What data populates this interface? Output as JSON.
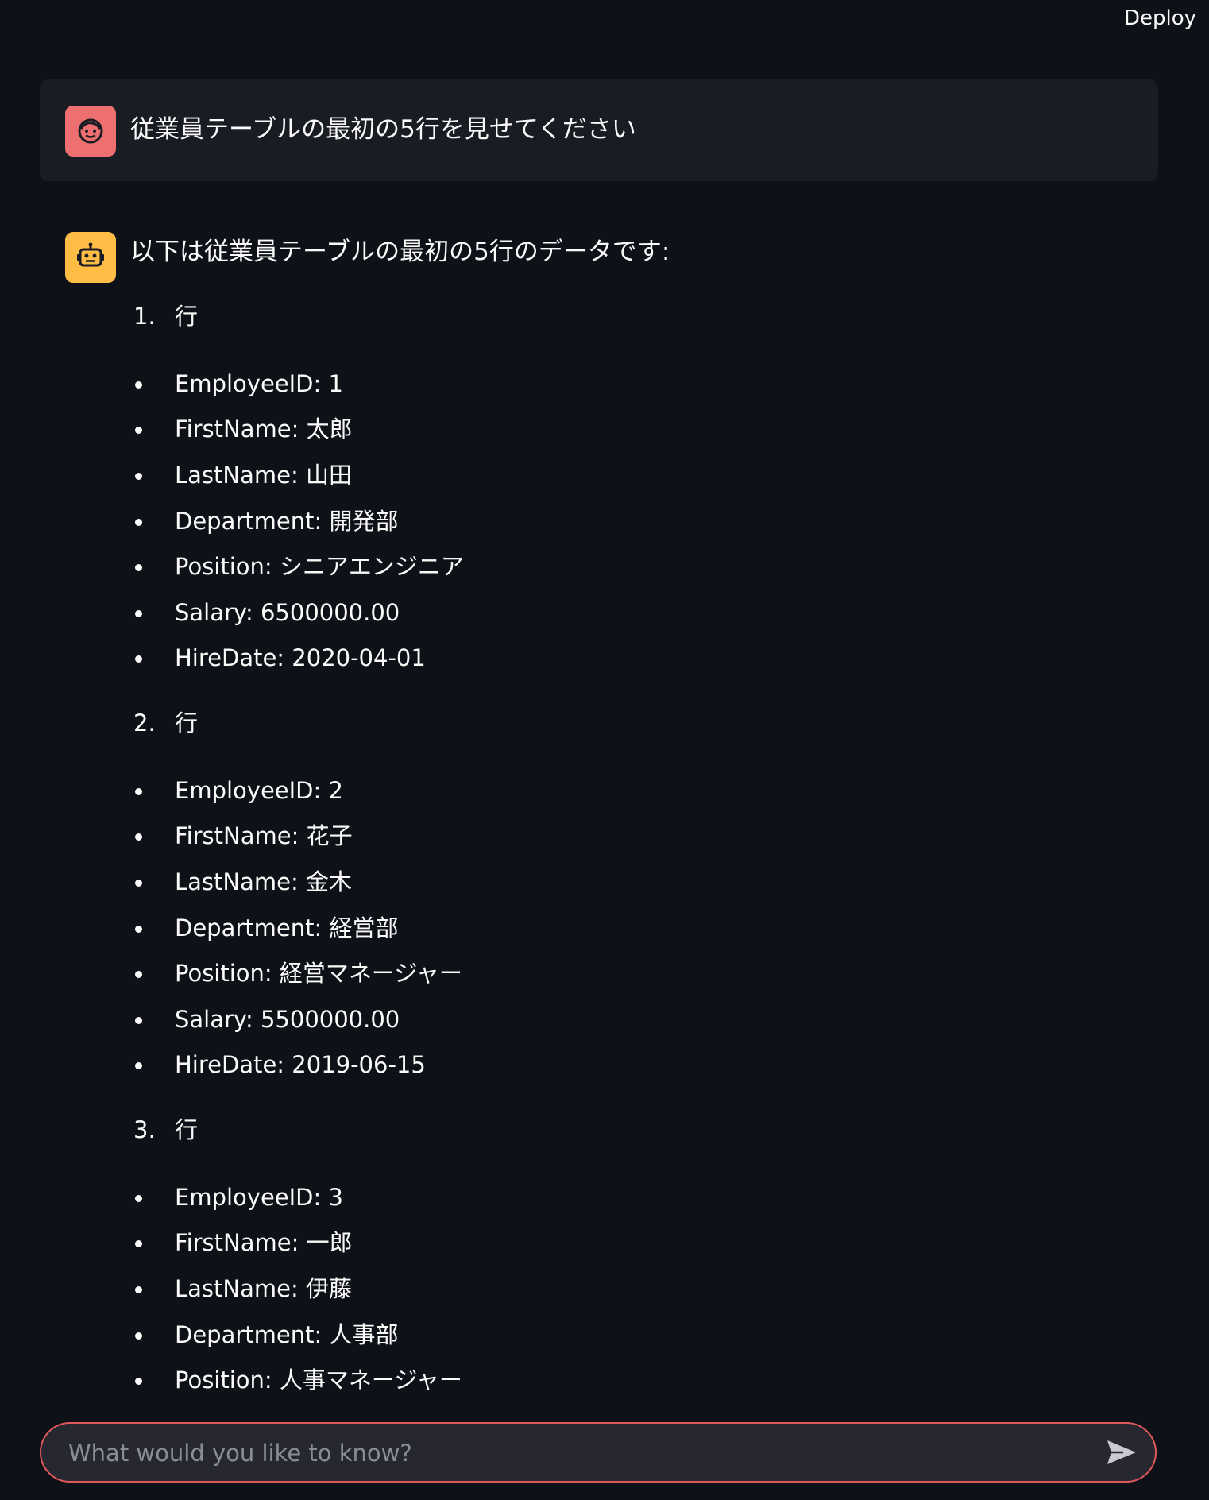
{
  "header": {
    "deploy_label": "Deploy"
  },
  "user_message": {
    "avatar_icon": "face-icon",
    "text": "従業員テーブルの最初の5行を見せてください"
  },
  "assistant_message": {
    "avatar_icon": "robot-icon",
    "intro": "以下は従業員テーブルの最初の5行のデータです:",
    "rows": [
      {
        "number": "1.",
        "label": "行",
        "fields": [
          "EmployeeID: 1",
          "FirstName: 太郎",
          "LastName: 山田",
          "Department: 開発部",
          "Position: シニアエンジニア",
          "Salary: 6500000.00",
          "HireDate: 2020-04-01"
        ]
      },
      {
        "number": "2.",
        "label": "行",
        "fields": [
          "EmployeeID: 2",
          "FirstName: 花子",
          "LastName: 金木",
          "Department: 経営部",
          "Position: 経営マネージャー",
          "Salary: 5500000.00",
          "HireDate: 2019-06-15"
        ]
      },
      {
        "number": "3.",
        "label": "行",
        "fields": [
          "EmployeeID: 3",
          "FirstName: 一郎",
          "LastName: 伊藤",
          "Department: 人事部",
          "Position: 人事マネージャー"
        ]
      }
    ]
  },
  "chat_input": {
    "placeholder": "What would you like to know?",
    "send_icon": "send-icon"
  },
  "colors": {
    "background": "#0e1117",
    "user_bubble": "#1a1c24",
    "user_avatar": "#ee6f6f",
    "bot_avatar": "#ffbd45",
    "input_border": "#e0595a"
  }
}
